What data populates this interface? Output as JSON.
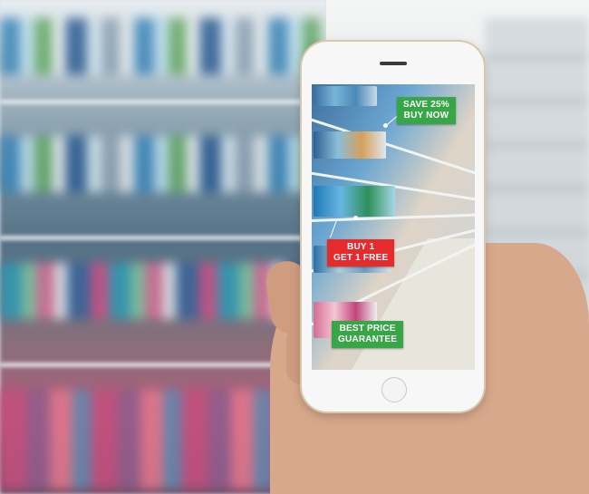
{
  "ar_tags": [
    {
      "line1": "SAVE 25%",
      "line2": "BUY NOW"
    },
    {
      "line1": "BUY 1",
      "line2": "GET 1 FREE"
    },
    {
      "line1": "BEST PRICE",
      "line2": "GUARANTEE"
    }
  ],
  "colors": {
    "tag_green": "#36a646",
    "tag_red": "#e52b2b",
    "phone_body": "#f7f7f7"
  }
}
